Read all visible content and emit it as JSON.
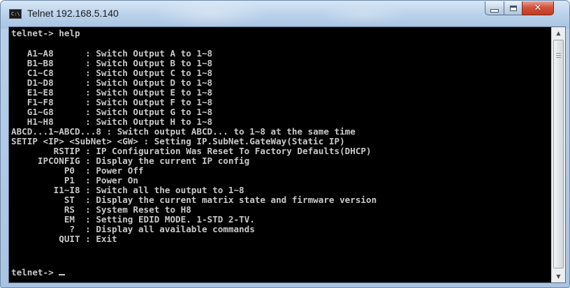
{
  "window": {
    "title": "Telnet 192.168.5.140",
    "icon": "console-app-icon",
    "controls": {
      "minimize": "minimize-icon",
      "maximize": "maximize-icon",
      "close_glyph": "✕"
    }
  },
  "console": {
    "lines": [
      "telnet-> help",
      "",
      "   A1~A8      : Switch Output A to 1~8",
      "   B1~B8      : Switch Output B to 1~8",
      "   C1~C8      : Switch Output C to 1~8",
      "   D1~D8      : Switch Output D to 1~8",
      "   E1~E8      : Switch Output E to 1~8",
      "   F1~F8      : Switch Output F to 1~8",
      "   G1~G8      : Switch Output G to 1~8",
      "   H1~H8      : Switch Output H to 1~8",
      "ABCD...1~ABCD...8 : Switch output ABCD... to 1~8 at the same time",
      "SETIP <IP> <SubNet> <GW> : Setting IP.SubNet.GateWay(Static IP)",
      "        RSTIP : IP Configuration Was Reset To Factory Defaults(DHCP)",
      "     IPCONFIG : Display the current IP config",
      "          P0  : Power Off",
      "          P1  : Power On",
      "        I1~I8 : Switch all the output to 1~8",
      "          ST  : Display the current matrix state and firmware version",
      "          RS  : System Reset to H8",
      "          EM  : Setting EDID MODE. 1-STD 2-TV.",
      "           ?  : Display all available commands",
      "         QUIT : Exit"
    ],
    "prompt": "telnet-> "
  },
  "scrollbar": {
    "up_arrow": "▲",
    "down_arrow": "▼"
  }
}
